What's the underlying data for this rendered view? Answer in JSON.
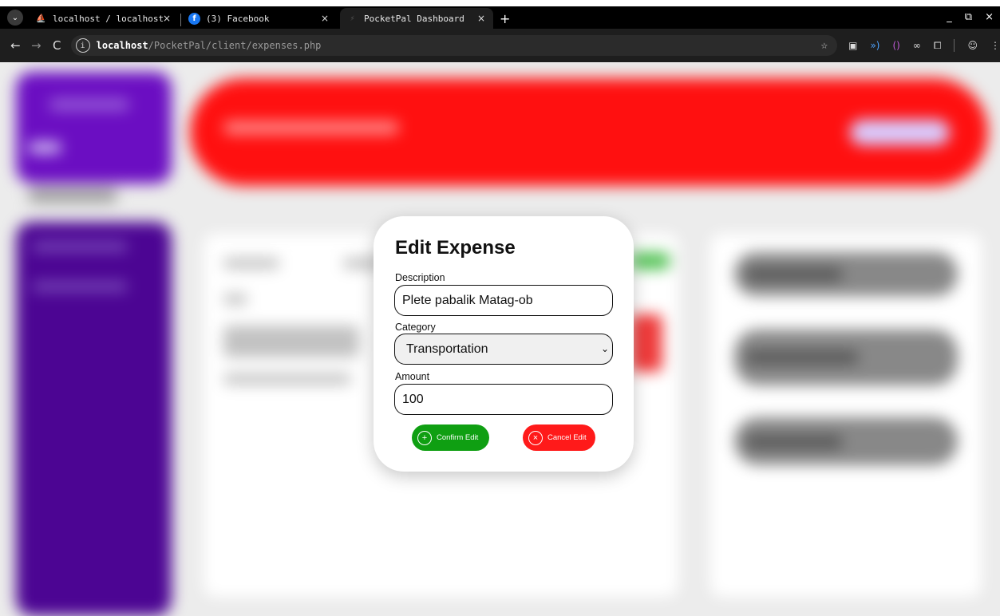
{
  "browser": {
    "tabs": [
      {
        "title": "localhost / localhost",
        "close": "×",
        "favicon": "phpmyadmin-icon",
        "active": false
      },
      {
        "title": "(3) Facebook",
        "close": "×",
        "favicon": "facebook-icon",
        "active": false
      },
      {
        "title": "PocketPal Dashboard",
        "close": "×",
        "favicon": "pocketpal-icon",
        "active": true
      }
    ],
    "tab_menu_glyph": "⌄",
    "new_tab_glyph": "+",
    "window_controls": [
      "_",
      "⧉",
      "×"
    ],
    "nav": {
      "back": "←",
      "forward": "→",
      "reload": "C"
    },
    "url_host": "localhost",
    "url_path": "/PocketPal/client/expenses.php",
    "bookmark_glyph": "☆"
  },
  "modal": {
    "title": "Edit Expense",
    "description_label": "Description",
    "description_value": "Plete pabalik Matag-ob",
    "category_label": "Category",
    "category_value": "Transportation",
    "amount_label": "Amount",
    "amount_value": "100",
    "confirm_label": "Confirm Edit",
    "cancel_label": "Cancel Edit",
    "confirm_icon_glyph": "+",
    "cancel_icon_glyph": "×"
  },
  "colors": {
    "sidebar": "#4c0593",
    "banner": "#ff1010",
    "confirm": "#0f9f12",
    "cancel": "#ff1a1a"
  }
}
